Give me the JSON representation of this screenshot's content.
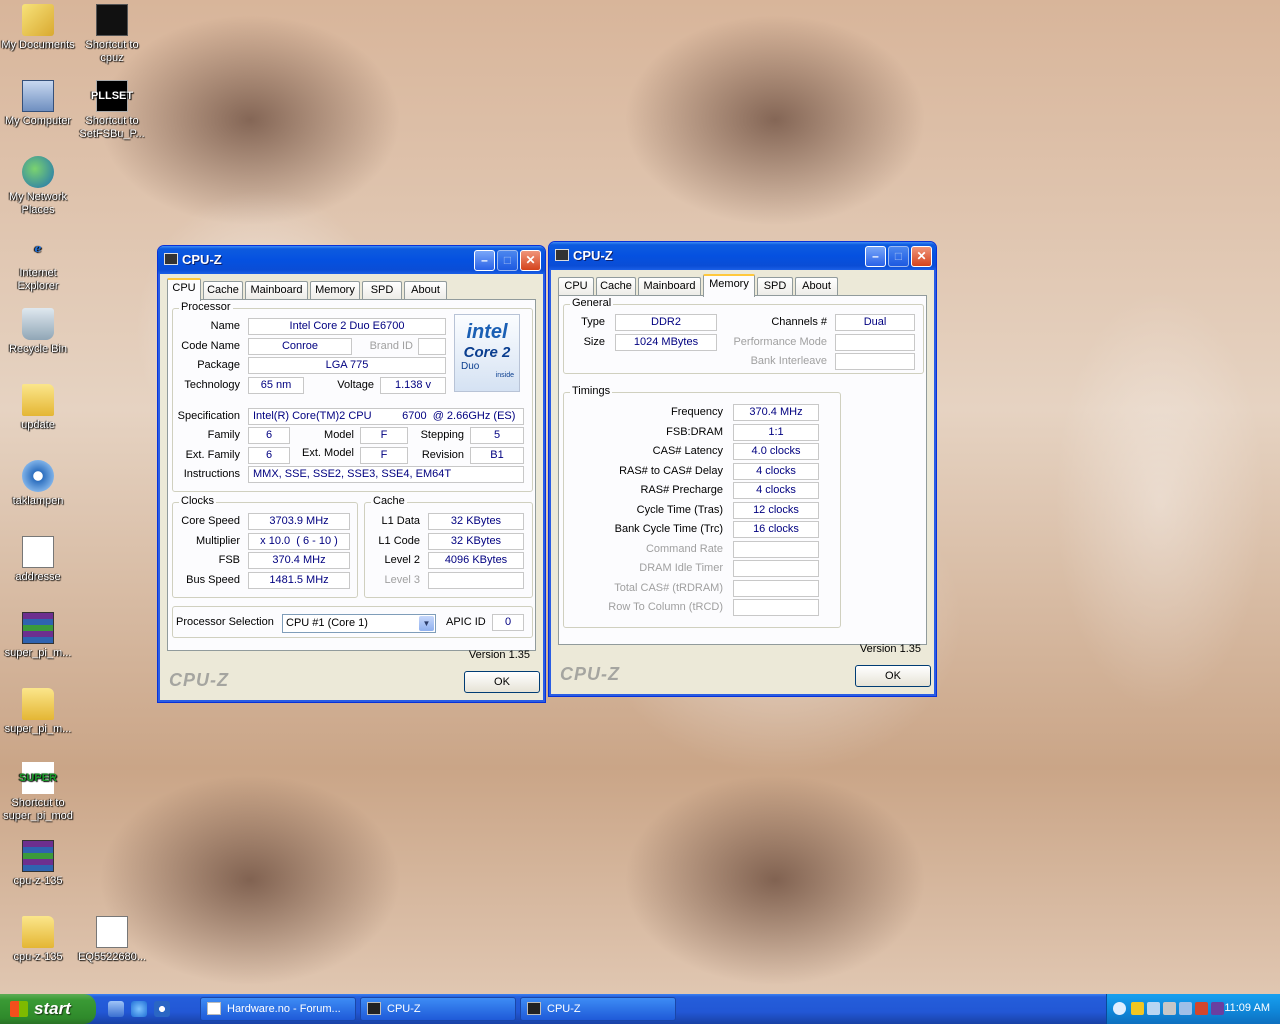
{
  "desktop_icons": [
    {
      "label": "My Documents",
      "icon": "my-documents-icon"
    },
    {
      "label": "Shortcut to cpuz",
      "icon": "cpuz-shortcut-icon"
    },
    {
      "label": "My Computer",
      "icon": "my-computer-icon"
    },
    {
      "label": "Shortcut to SetFSBu_P...",
      "icon": "setfsb-shortcut-icon"
    },
    {
      "label": "My Network Places",
      "icon": "network-places-icon"
    },
    {
      "label": "Internet Explorer",
      "icon": "internet-explorer-icon"
    },
    {
      "label": "Recycle Bin",
      "icon": "recycle-bin-icon"
    },
    {
      "label": "update",
      "icon": "folder-icon"
    },
    {
      "label": "taklampen",
      "icon": "media-file-icon"
    },
    {
      "label": "addresse",
      "icon": "document-icon"
    },
    {
      "label": "super_pi_m...",
      "icon": "rar-archive-icon"
    },
    {
      "label": "super_pi_m...",
      "icon": "folder-icon"
    },
    {
      "label": "Shortcut to super_pi_mod",
      "icon": "super-pi-shortcut-icon"
    },
    {
      "label": "cpu-z-135",
      "icon": "rar-archive-icon"
    },
    {
      "label": "cpu-z-135",
      "icon": "folder-icon"
    },
    {
      "label": "EQ5522680...",
      "icon": "document-icon"
    }
  ],
  "icon_glyphs": {
    "pll": "PLL",
    "set": "SET",
    "super": "SUPER",
    "ie": "e"
  },
  "window_cpu": {
    "title": "CPU-Z",
    "tabs": [
      "CPU",
      "Cache",
      "Mainboard",
      "Memory",
      "SPD",
      "About"
    ],
    "active_tab": "CPU",
    "processor": {
      "group": "Processor",
      "name_label": "Name",
      "name": "Intel Core 2 Duo E6700",
      "codename_label": "Code Name",
      "codename": "Conroe",
      "brandid_label": "Brand ID",
      "brandid": "",
      "package_label": "Package",
      "package": "LGA 775",
      "technology_label": "Technology",
      "technology": "65 nm",
      "voltage_label": "Voltage",
      "voltage": "1.138 v",
      "spec_label": "Specification",
      "spec": "Intel(R) Core(TM)2 CPU          6700  @ 2.66GHz (ES)",
      "family_label": "Family",
      "family": "6",
      "model_label": "Model",
      "model": "F",
      "stepping_label": "Stepping",
      "stepping": "5",
      "extfamily_label": "Ext. Family",
      "extfamily": "6",
      "extmodel_label": "Ext. Model",
      "extmodel": "F",
      "revision_label": "Revision",
      "revision": "B1",
      "instructions_label": "Instructions",
      "instructions": "MMX, SSE, SSE2, SSE3, SSE4, EM64T",
      "logo_line1": "intel",
      "logo_line2": "Core 2",
      "logo_line3": "Duo",
      "logo_line4": "inside"
    },
    "clocks": {
      "group": "Clocks",
      "corespeed_label": "Core Speed",
      "corespeed": "3703.9 MHz",
      "multiplier_label": "Multiplier",
      "multiplier": "x 10.0  ( 6 - 10 )",
      "fsb_label": "FSB",
      "fsb": "370.4 MHz",
      "busspeed_label": "Bus Speed",
      "busspeed": "1481.5 MHz"
    },
    "cache": {
      "group": "Cache",
      "l1data_label": "L1 Data",
      "l1data": "32 KBytes",
      "l1code_label": "L1 Code",
      "l1code": "32 KBytes",
      "level2_label": "Level 2",
      "level2": "4096 KBytes",
      "level3_label": "Level 3",
      "level3": ""
    },
    "selection_label": "Processor Selection",
    "selection_value": "CPU #1 (Core 1)",
    "apicid_label": "APIC ID",
    "apicid": "0",
    "version": "Version 1.35",
    "logo": "CPU-Z",
    "ok": "OK"
  },
  "window_mem": {
    "title": "CPU-Z",
    "tabs": [
      "CPU",
      "Cache",
      "Mainboard",
      "Memory",
      "SPD",
      "About"
    ],
    "active_tab": "Memory",
    "general": {
      "group": "General",
      "type_label": "Type",
      "type": "DDR2",
      "size_label": "Size",
      "size": "1024 MBytes",
      "channels_label": "Channels #",
      "channels": "Dual",
      "perfmode_label": "Performance Mode",
      "perfmode": "",
      "bankinterleave_label": "Bank Interleave",
      "bankinterleave": ""
    },
    "timings": {
      "group": "Timings",
      "rows": [
        {
          "label": "Frequency",
          "value": "370.4 MHz",
          "dim": false
        },
        {
          "label": "FSB:DRAM",
          "value": "1:1",
          "dim": false
        },
        {
          "label": "CAS# Latency",
          "value": "4.0 clocks",
          "dim": false
        },
        {
          "label": "RAS# to CAS# Delay",
          "value": "4 clocks",
          "dim": false
        },
        {
          "label": "RAS# Precharge",
          "value": "4 clocks",
          "dim": false
        },
        {
          "label": "Cycle Time (Tras)",
          "value": "12 clocks",
          "dim": false
        },
        {
          "label": "Bank Cycle Time (Trc)",
          "value": "16 clocks",
          "dim": false
        },
        {
          "label": "Command Rate",
          "value": "",
          "dim": true
        },
        {
          "label": "DRAM Idle Timer",
          "value": "",
          "dim": true
        },
        {
          "label": "Total CAS# (tRDRAM)",
          "value": "",
          "dim": true
        },
        {
          "label": "Row To Column (tRCD)",
          "value": "",
          "dim": true
        }
      ]
    },
    "version": "Version 1.35",
    "logo": "CPU-Z",
    "ok": "OK"
  },
  "taskbar": {
    "start": "start",
    "buttons": [
      {
        "label": "Hardware.no - Forum...",
        "icon": "browser-icon"
      },
      {
        "label": "CPU-Z",
        "icon": "cpuz-icon"
      },
      {
        "label": "CPU-Z",
        "icon": "cpuz-icon"
      }
    ],
    "clock": "11:09 AM"
  },
  "colors": {
    "title_blue": "#0551e0",
    "value_text": "#000080",
    "start_green": "#3a9a35",
    "tray_blue": "#0f85d7"
  }
}
